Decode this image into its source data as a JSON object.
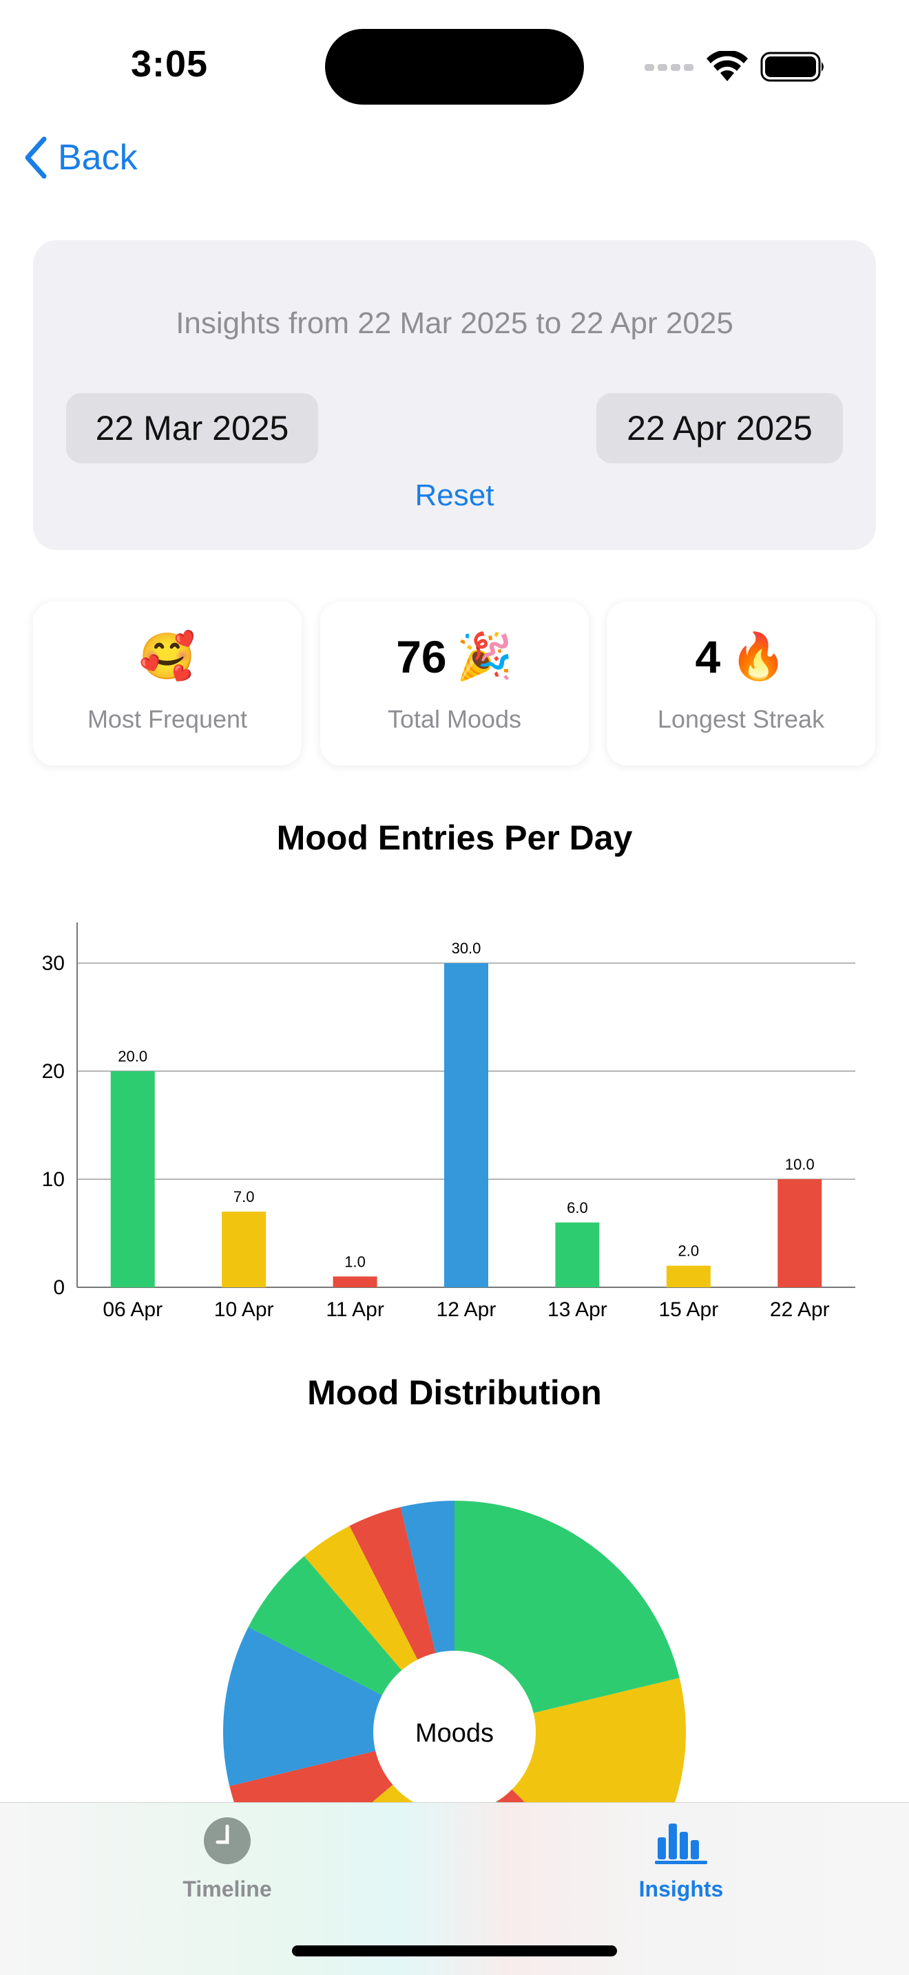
{
  "status_bar": {
    "time": "3:05"
  },
  "nav": {
    "back_label": "Back"
  },
  "date_filter": {
    "summary": "Insights from 22 Mar 2025 to 22 Apr 2025",
    "start_date": "22 Mar 2025",
    "end_date": "22 Apr 2025",
    "reset_label": "Reset"
  },
  "stats": {
    "most_frequent": {
      "emoji": "🥰",
      "label": "Most Frequent"
    },
    "total_moods": {
      "value": "76",
      "emoji": "🎉",
      "label": "Total Moods"
    },
    "longest_streak": {
      "value": "4",
      "emoji": "🔥",
      "label": "Longest Streak"
    }
  },
  "chart_data": [
    {
      "type": "bar",
      "title": "Mood Entries Per Day",
      "categories": [
        "06 Apr",
        "10 Apr",
        "11 Apr",
        "12 Apr",
        "13 Apr",
        "15 Apr",
        "22 Apr"
      ],
      "values": [
        20,
        7,
        1,
        30,
        6,
        2,
        10
      ],
      "value_labels": [
        "20.0",
        "7.0",
        "1.0",
        "30.0",
        "6.0",
        "2.0",
        "10.0"
      ],
      "colors": [
        "#2ecc71",
        "#f1c40f",
        "#e74c3c",
        "#3498db",
        "#2ecc71",
        "#f1c40f",
        "#e74c3c"
      ],
      "yticks": [
        "0",
        "10",
        "20",
        "30"
      ],
      "ylim": [
        0,
        33
      ],
      "grid": true,
      "xlabel": "",
      "ylabel": ""
    },
    {
      "type": "pie",
      "title": "Mood Distribution",
      "center_label": "Moods",
      "values": [
        17,
        13,
        3,
        6,
        12,
        6,
        9,
        5,
        3,
        3,
        3
      ],
      "colors": [
        "#2ecc71",
        "#f1c40f",
        "#e74c3c",
        "#2ecc71",
        "#f1c40f",
        "#e74c3c",
        "#3498db",
        "#2ecc71",
        "#f1c40f",
        "#e74c3c",
        "#3498db"
      ]
    }
  ],
  "tabs": [
    {
      "label": "Timeline",
      "icon": "clock-icon",
      "active": false,
      "color": "#8e8e93"
    },
    {
      "label": "Insights",
      "icon": "bar-chart-icon",
      "active": true,
      "color": "#1a7ee6"
    }
  ]
}
